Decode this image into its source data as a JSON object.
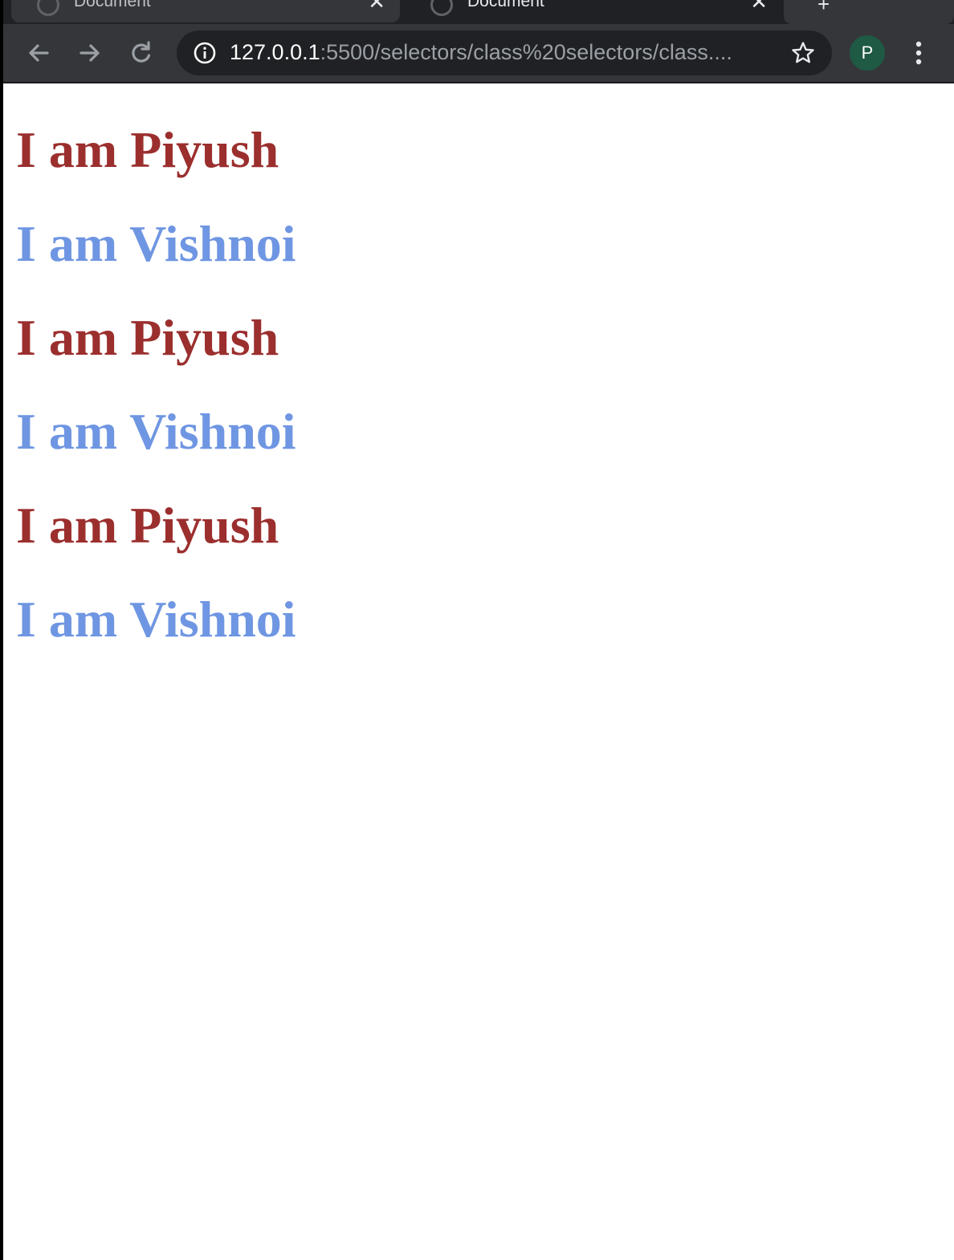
{
  "browser": {
    "tabs": [
      {
        "title": "Document",
        "active": false
      },
      {
        "title": "Document",
        "active": true
      }
    ],
    "tab_close_glyph": "✕",
    "new_tab_glyph": "+",
    "url_host": "127.0.0.1",
    "url_path": ":5500/selectors/class%20selectors/class....",
    "profile_initial": "P",
    "colors": {
      "tabstrip": "#202124",
      "toolbar": "#35363a",
      "omnibox": "#202124",
      "avatar": "#1e5a44"
    },
    "icons": [
      "back-arrow-icon",
      "forward-arrow-icon",
      "reload-icon",
      "info-icon",
      "star-icon",
      "kebab-menu-icon"
    ]
  },
  "page": {
    "headings": [
      {
        "text": "I am Piyush",
        "color": "#9b2f2e"
      },
      {
        "text": "I am Vishnoi",
        "color": "#6f96e2"
      },
      {
        "text": "I am Piyush",
        "color": "#9b2f2e"
      },
      {
        "text": "I am Vishnoi",
        "color": "#6f96e2"
      },
      {
        "text": "I am Piyush",
        "color": "#9b2f2e"
      },
      {
        "text": "I am Vishnoi",
        "color": "#6f96e2"
      }
    ]
  }
}
